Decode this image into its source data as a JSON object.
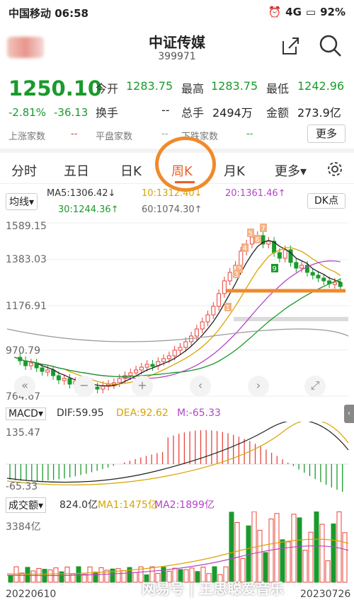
{
  "status_bar": {
    "carrier_time": "中国移动 06:58",
    "signal": "4G",
    "battery": "92%"
  },
  "header": {
    "title": "中证传媒",
    "code": "399971"
  },
  "quote": {
    "price": "1250.10",
    "change_pct": "-2.81%",
    "change": "-36.13",
    "open_label": "今开",
    "open": "1283.75",
    "high_label": "最高",
    "high": "1283.75",
    "low_label": "最低",
    "low": "1242.96",
    "turnover_label": "换手",
    "turnover": "--",
    "volume_label": "总手",
    "volume": "2494万",
    "amount_label": "金额",
    "amount": "273.9亿",
    "up_label": "上涨家数",
    "up": "--",
    "flat_label": "平盘家数",
    "flat": "--",
    "down_label": "下跌家数",
    "down": "--",
    "more": "更多"
  },
  "tabs": [
    {
      "label": "分时"
    },
    {
      "label": "五日"
    },
    {
      "label": "日K"
    },
    {
      "label": "周K"
    },
    {
      "label": "月K"
    },
    {
      "label": "更多▾"
    }
  ],
  "ma": {
    "type_label": "均线▾",
    "ma5": "MA5:1306.42↓",
    "ma10": "10:1312.40↓",
    "ma20": "20:1361.46↑",
    "ma30": "30:1244.36↑",
    "ma60": "60:1074.30↑",
    "dk_label": "DK点"
  },
  "price_axis": [
    "1589.15",
    "1383.03",
    "1176.91",
    "970.79",
    "764.67"
  ],
  "macd": {
    "label": "MACD▾",
    "dif": "DIF:59.95",
    "dea": "DEA:92.62",
    "m": "M:-65.33",
    "top": "135.47",
    "bottom": "-65.33"
  },
  "volume": {
    "label": "成交额▾",
    "value": "824.0亿",
    "ma1": "MA1:1475亿",
    "ma2": "MA2:1899亿",
    "top": "3384亿"
  },
  "dates": {
    "start": "20220610",
    "end": "20230726"
  },
  "watermark": "网易号 | 王思聪爱音乐",
  "colors": {
    "up": "#e8433a",
    "down": "#1a9a2c",
    "accent": "#e8612a"
  }
}
